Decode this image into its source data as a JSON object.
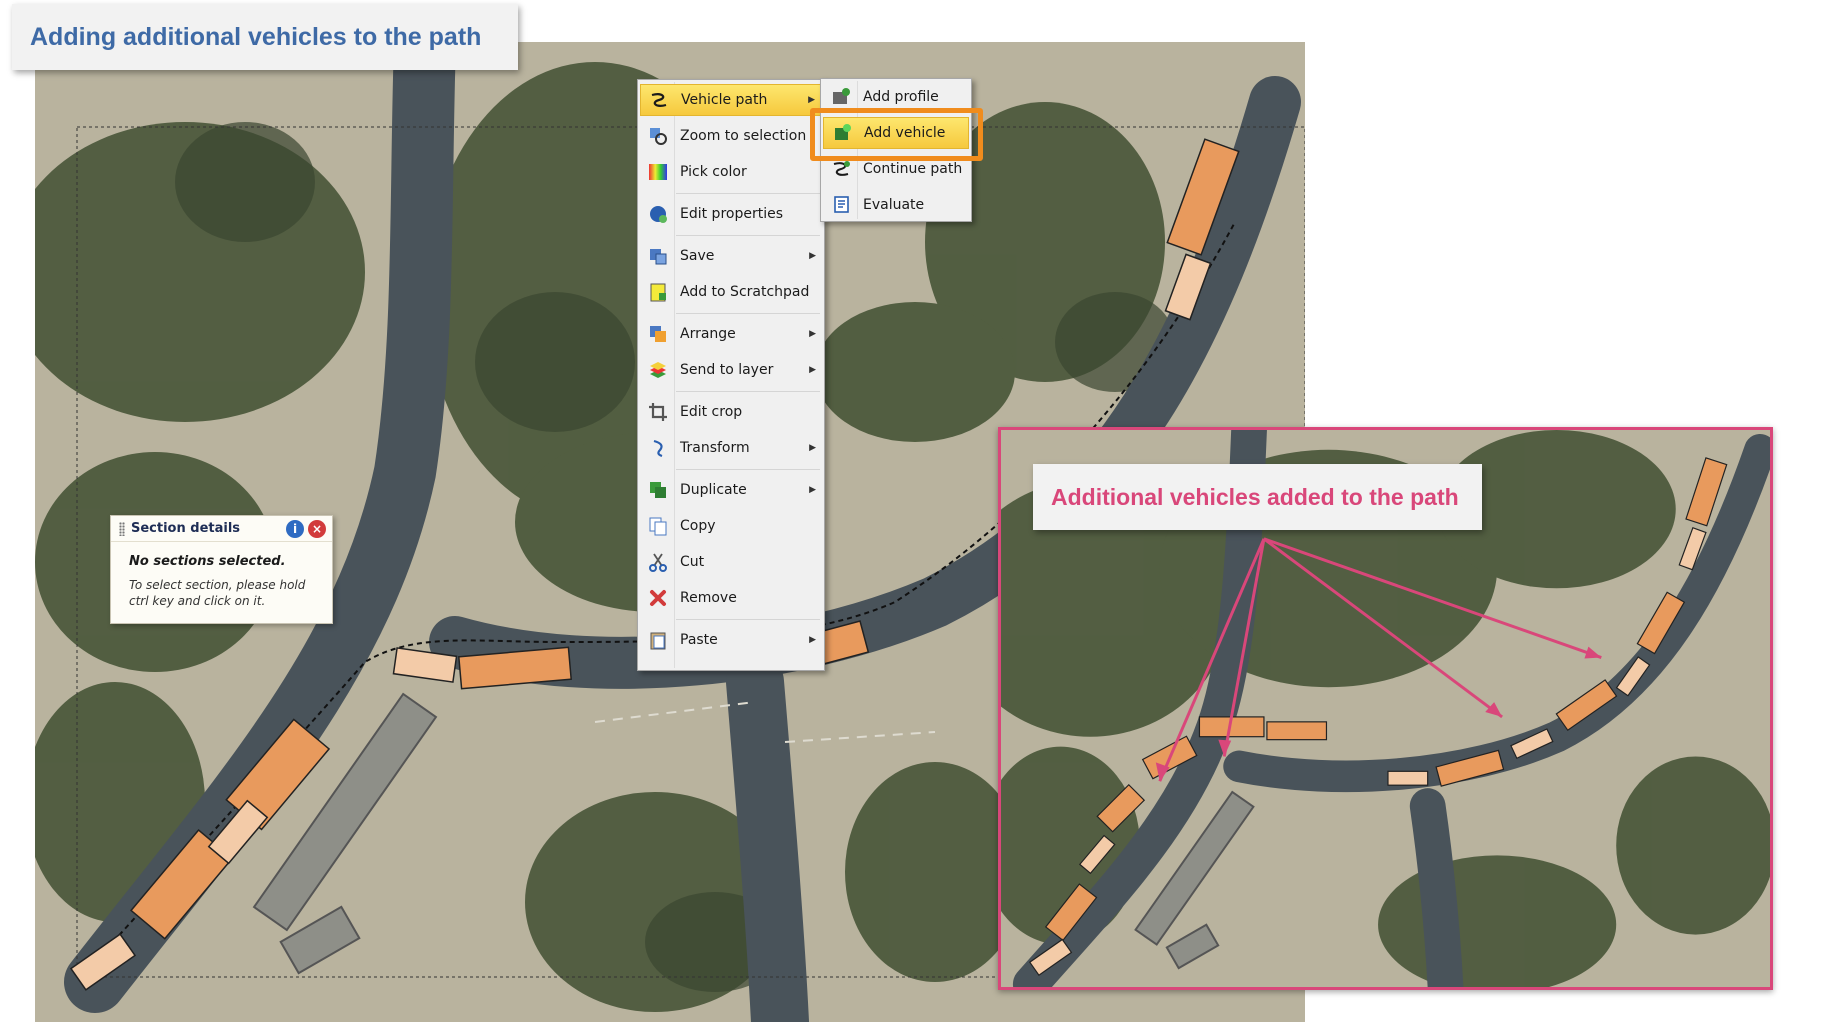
{
  "header": {
    "title": "Adding additional vehicles to the path"
  },
  "inset": {
    "caption": "Additional vehicles added to the path"
  },
  "context_menu": {
    "items": [
      {
        "label": "Vehicle path",
        "icon": "vehicle-path-icon",
        "has_submenu": true,
        "highlighted": true
      },
      {
        "label": "Zoom to selection",
        "icon": "zoom-to-selection-icon",
        "has_submenu": false
      },
      {
        "label": "Pick color",
        "icon": "pick-color-icon",
        "has_submenu": false
      },
      {
        "label": "Edit properties",
        "icon": "edit-properties-icon",
        "has_submenu": false
      },
      {
        "label": "Save",
        "icon": "save-icon",
        "has_submenu": true
      },
      {
        "label": "Add to Scratchpad",
        "icon": "scratchpad-icon",
        "has_submenu": false
      },
      {
        "label": "Arrange",
        "icon": "arrange-icon",
        "has_submenu": true
      },
      {
        "label": "Send to layer",
        "icon": "layers-icon",
        "has_submenu": true
      },
      {
        "label": "Edit crop",
        "icon": "crop-icon",
        "has_submenu": false
      },
      {
        "label": "Transform",
        "icon": "transform-icon",
        "has_submenu": true
      },
      {
        "label": "Duplicate",
        "icon": "duplicate-icon",
        "has_submenu": true
      },
      {
        "label": "Copy",
        "icon": "copy-icon",
        "has_submenu": false
      },
      {
        "label": "Cut",
        "icon": "scissors-icon",
        "has_submenu": false
      },
      {
        "label": "Remove",
        "icon": "remove-x-icon",
        "has_submenu": false
      },
      {
        "label": "Paste",
        "icon": "paste-icon",
        "has_submenu": true
      }
    ]
  },
  "submenu": {
    "items": [
      {
        "label": "Add profile",
        "icon": "add-profile-icon"
      },
      {
        "label": "Add vehicle",
        "icon": "add-vehicle-icon",
        "highlighted": true
      },
      {
        "label": "Continue path",
        "icon": "continue-path-icon"
      },
      {
        "label": "Evaluate",
        "icon": "evaluate-icon"
      }
    ]
  },
  "section_details": {
    "title": "Section details",
    "status": "No sections selected.",
    "hint": "To select section, please hold ctrl key and click on it."
  },
  "colors": {
    "title_text": "#3e6aa6",
    "inset_accent": "#d9477a",
    "highlight_orange": "#f08c1d",
    "vehicle_fill": "#e89a5d",
    "menu_highlight": "#f6c93d"
  }
}
